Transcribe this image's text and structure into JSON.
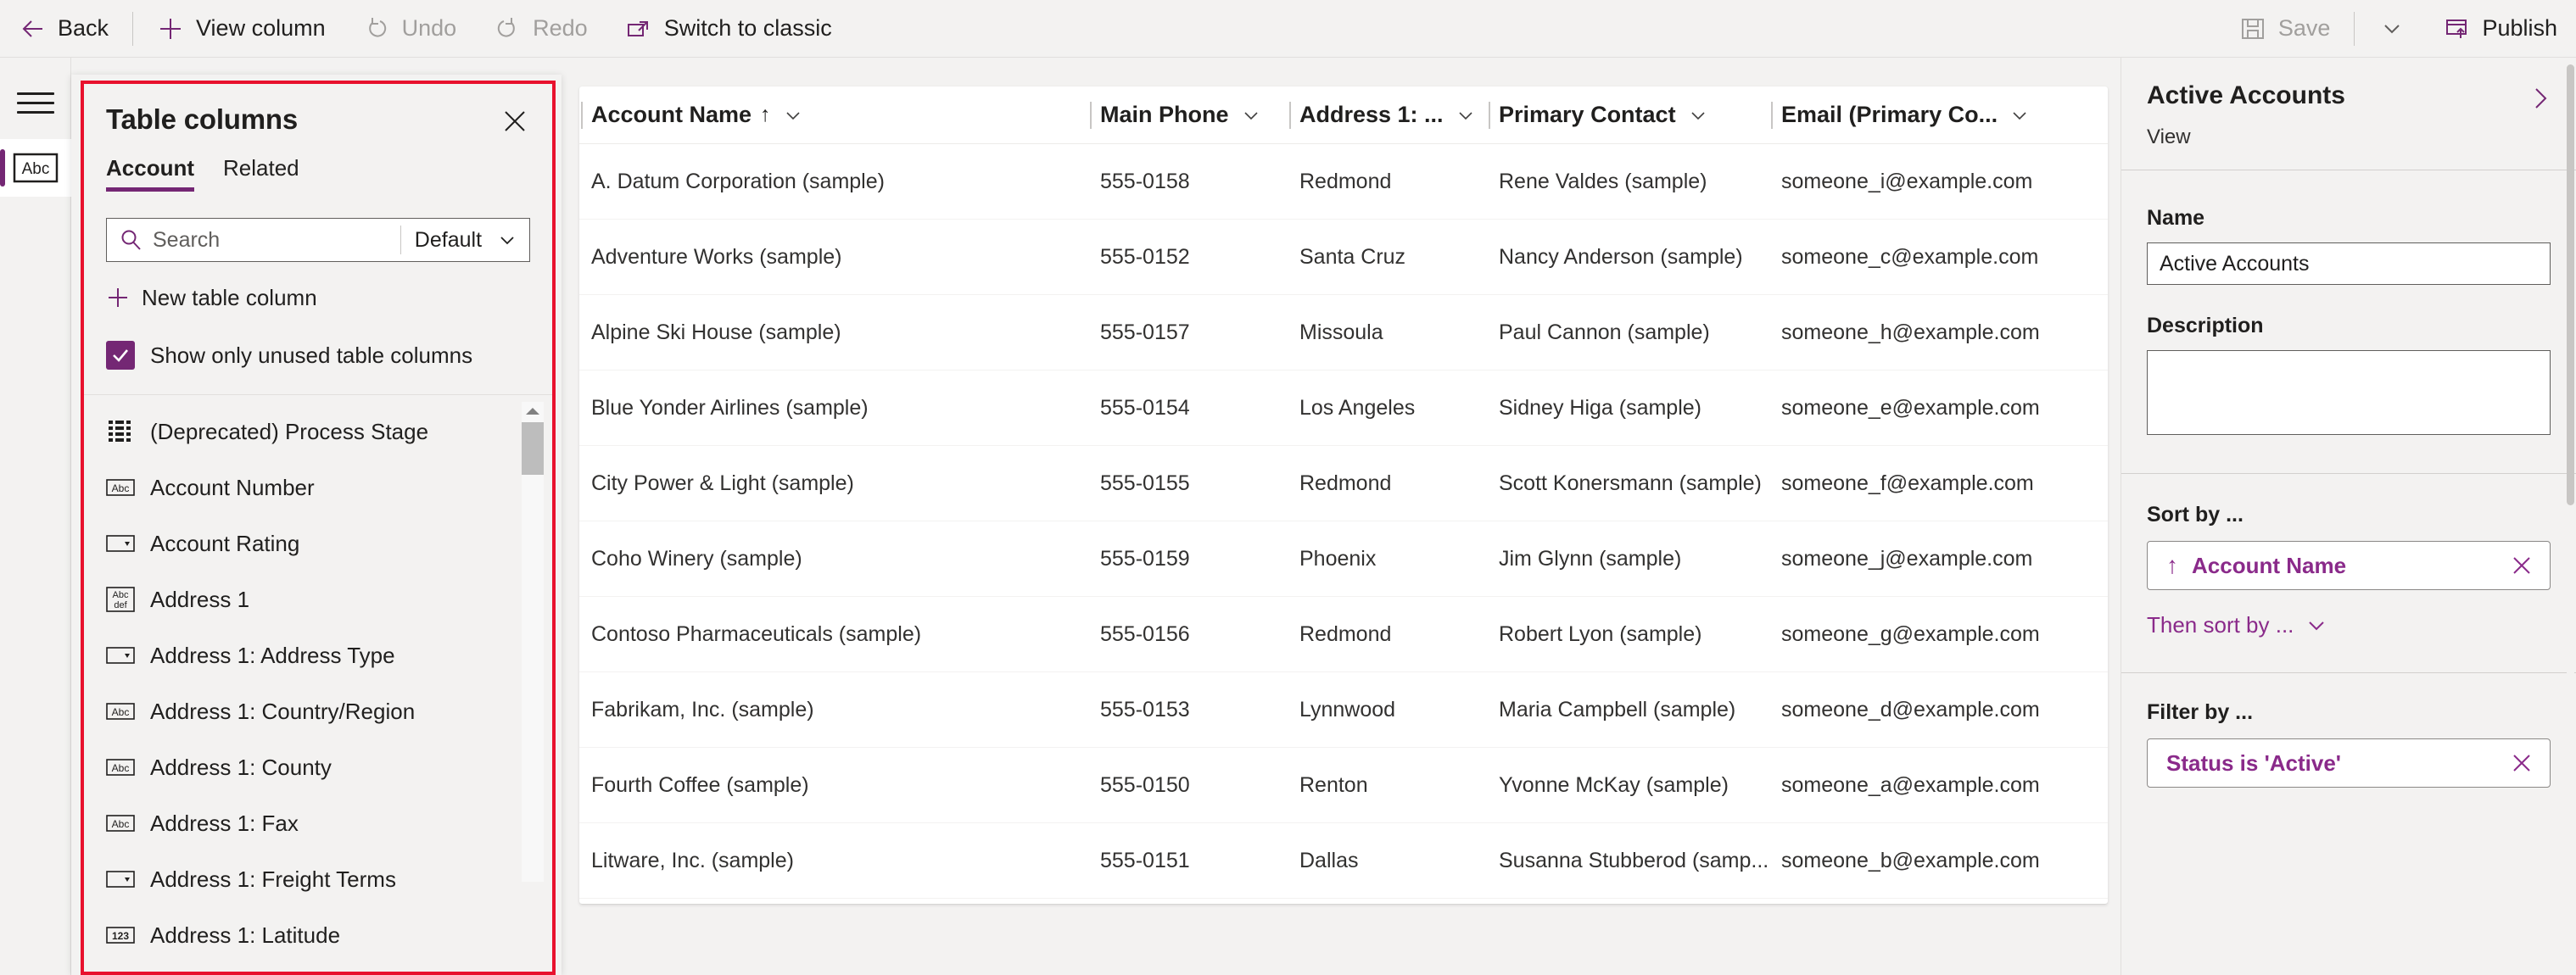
{
  "colors": {
    "accent": "#742774",
    "accent_text": "#8a2a8a",
    "annotation": "#e8112d",
    "chrome_bg": "#f3f2f1",
    "text": "#201f1e",
    "disabled": "#a19f9d"
  },
  "commandbar": {
    "back": "Back",
    "view_column": "View column",
    "undo": "Undo",
    "redo": "Redo",
    "switch_to_classic": "Switch to classic",
    "save": "Save",
    "publish": "Publish"
  },
  "rail": {
    "menu_label": "hamburger-menu",
    "item_label": "Abc"
  },
  "table_columns_panel": {
    "title": "Table columns",
    "close_label": "Close",
    "tabs": [
      {
        "label": "Account",
        "active": true
      },
      {
        "label": "Related",
        "active": false
      }
    ],
    "search": {
      "placeholder": "Search",
      "value": ""
    },
    "filter_select": {
      "value": "Default"
    },
    "new_column": "New table column",
    "show_unused": {
      "label": "Show only unused table columns",
      "checked": true
    },
    "columns": [
      {
        "label": "(Deprecated) Process Stage",
        "icon": "multiline-list"
      },
      {
        "label": "Account Number",
        "icon": "text-abc"
      },
      {
        "label": "Account Rating",
        "icon": "choice-dropdown"
      },
      {
        "label": "Address 1",
        "icon": "multiline-text"
      },
      {
        "label": "Address 1: Address Type",
        "icon": "choice-dropdown"
      },
      {
        "label": "Address 1: Country/Region",
        "icon": "text-abc"
      },
      {
        "label": "Address 1: County",
        "icon": "text-abc"
      },
      {
        "label": "Address 1: Fax",
        "icon": "text-abc"
      },
      {
        "label": "Address 1: Freight Terms",
        "icon": "choice-dropdown"
      },
      {
        "label": "Address 1: Latitude",
        "icon": "number-123"
      }
    ]
  },
  "grid": {
    "headers": [
      {
        "label": "Account Name",
        "sorted": true,
        "sort_arrow": "↑",
        "key": "name"
      },
      {
        "label": "Main Phone",
        "sorted": false,
        "key": "phone"
      },
      {
        "label": "Address 1: ...",
        "sorted": false,
        "key": "addr"
      },
      {
        "label": "Primary Contact",
        "sorted": false,
        "key": "contact"
      },
      {
        "label": "Email (Primary Co...",
        "sorted": false,
        "key": "email"
      }
    ],
    "rows": [
      {
        "name": "A. Datum Corporation (sample)",
        "phone": "555-0158",
        "addr": "Redmond",
        "contact": "Rene Valdes (sample)",
        "email": "someone_i@example.com"
      },
      {
        "name": "Adventure Works (sample)",
        "phone": "555-0152",
        "addr": "Santa Cruz",
        "contact": "Nancy Anderson (sample)",
        "email": "someone_c@example.com"
      },
      {
        "name": "Alpine Ski House (sample)",
        "phone": "555-0157",
        "addr": "Missoula",
        "contact": "Paul Cannon (sample)",
        "email": "someone_h@example.com"
      },
      {
        "name": "Blue Yonder Airlines (sample)",
        "phone": "555-0154",
        "addr": "Los Angeles",
        "contact": "Sidney Higa (sample)",
        "email": "someone_e@example.com"
      },
      {
        "name": "City Power & Light (sample)",
        "phone": "555-0155",
        "addr": "Redmond",
        "contact": "Scott Konersmann (sample)",
        "email": "someone_f@example.com"
      },
      {
        "name": "Coho Winery (sample)",
        "phone": "555-0159",
        "addr": "Phoenix",
        "contact": "Jim Glynn (sample)",
        "email": "someone_j@example.com"
      },
      {
        "name": "Contoso Pharmaceuticals (sample)",
        "phone": "555-0156",
        "addr": "Redmond",
        "contact": "Robert Lyon (sample)",
        "email": "someone_g@example.com"
      },
      {
        "name": "Fabrikam, Inc. (sample)",
        "phone": "555-0153",
        "addr": "Lynnwood",
        "contact": "Maria Campbell (sample)",
        "email": "someone_d@example.com"
      },
      {
        "name": "Fourth Coffee (sample)",
        "phone": "555-0150",
        "addr": "Renton",
        "contact": "Yvonne McKay (sample)",
        "email": "someone_a@example.com"
      },
      {
        "name": "Litware, Inc. (sample)",
        "phone": "555-0151",
        "addr": "Dallas",
        "contact": "Susanna Stubberod (samp...",
        "email": "someone_b@example.com"
      }
    ]
  },
  "properties_pane": {
    "title": "Active Accounts",
    "subtitle": "View",
    "expand_label": "Expand",
    "name_label": "Name",
    "name_value": "Active Accounts",
    "description_label": "Description",
    "description_value": "",
    "sort_by_label": "Sort by ...",
    "sort_chip": {
      "arrow": "↑",
      "text": "Account Name"
    },
    "then_sort_by": "Then sort by ...",
    "filter_by_label": "Filter by ...",
    "filter_chip": {
      "text": "Status is 'Active'"
    }
  }
}
